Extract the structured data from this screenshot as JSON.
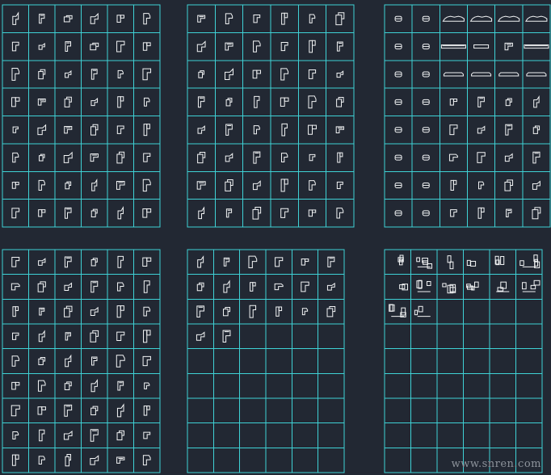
{
  "colors": {
    "background": "#222833",
    "grid": "#3fd2d6",
    "symbol": "#f2f4f5"
  },
  "watermark": "www.snren.com",
  "panels": [
    {
      "name": "panel-top-left",
      "cols": 6,
      "rows": 8,
      "filled": 48,
      "variant": "profile"
    },
    {
      "name": "panel-top-middle",
      "cols": 6,
      "rows": 8,
      "filled": 48,
      "variant": "profile"
    },
    {
      "name": "panel-top-right",
      "cols": 6,
      "rows": 8,
      "filled": 48,
      "variant": "mixed"
    },
    {
      "name": "panel-bottom-left",
      "cols": 6,
      "rows": 9,
      "filled": 54,
      "variant": "profile"
    },
    {
      "name": "panel-bottom-middle",
      "cols": 6,
      "rows": 9,
      "filled": 20,
      "variant": "profile"
    },
    {
      "name": "panel-bottom-right",
      "cols": 6,
      "rows": 9,
      "filled": 14,
      "variant": "cluster"
    }
  ]
}
